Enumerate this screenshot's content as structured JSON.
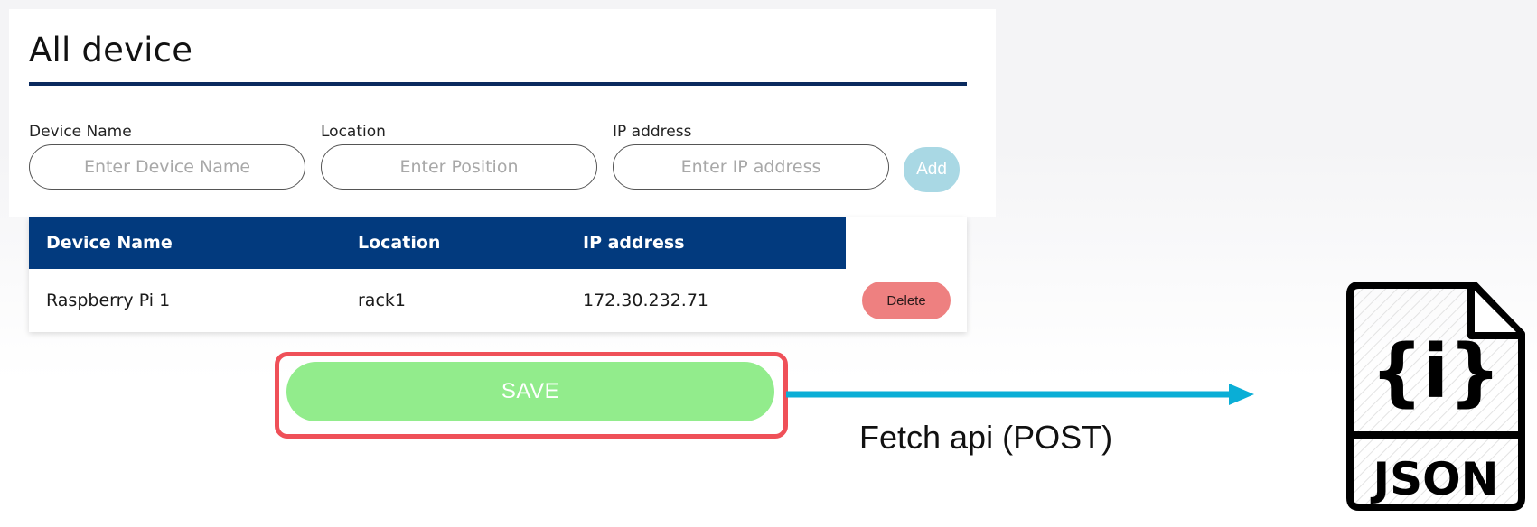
{
  "page": {
    "title": "All device"
  },
  "form": {
    "device_name": {
      "label": "Device Name",
      "placeholder": "Enter Device Name",
      "value": ""
    },
    "location": {
      "label": "Location",
      "placeholder": "Enter Position",
      "value": ""
    },
    "ip_address": {
      "label": "IP address",
      "placeholder": "Enter IP address",
      "value": ""
    },
    "add_label": "Add"
  },
  "table": {
    "headers": [
      "Device Name",
      "Location",
      "IP address"
    ],
    "rows": [
      {
        "device_name": "Raspberry Pi 1",
        "location": "rack1",
        "ip": "172.30.232.71",
        "delete_label": "Delete"
      }
    ]
  },
  "save_label": "SAVE",
  "annotation": {
    "caption": "Fetch api (POST)",
    "json_label": "JSON",
    "json_symbol": "{i}",
    "arrow_color": "#0aaed6",
    "highlight_color": "#ef5058",
    "icon": "json-file-icon"
  },
  "colors": {
    "header_bg": "#023a7e",
    "title_rule": "#0a2a5e",
    "add_button": "#a9d8e4",
    "delete_button": "#ee8080",
    "save_button": "#92ec8c"
  }
}
